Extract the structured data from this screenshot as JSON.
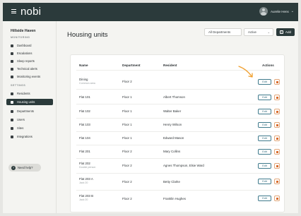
{
  "app": {
    "logo": "nobi",
    "user_name": "Aurelie Hens",
    "user_chevron": "⌄"
  },
  "sidebar": {
    "site_name": "Hillside Haven",
    "monitoring_label": "MONITORING",
    "settings_label": "SETTINGS",
    "monitoring_items": [
      {
        "label": "Dashboard",
        "icon": "grid-icon"
      },
      {
        "label": "Escalations",
        "icon": "pin-icon"
      },
      {
        "label": "Sleep reports",
        "icon": "report-icon"
      },
      {
        "label": "Technical alerts",
        "icon": "alert-icon"
      },
      {
        "label": "Monitoring events",
        "icon": "events-icon"
      }
    ],
    "settings_items": [
      {
        "label": "Residents",
        "icon": "people-icon",
        "active": false
      },
      {
        "label": "Housing units",
        "icon": "home-icon",
        "active": true
      },
      {
        "label": "Departments",
        "icon": "building-icon",
        "active": false
      },
      {
        "label": "Users",
        "icon": "users-icon",
        "active": false
      },
      {
        "label": "Sites",
        "icon": "house-icon",
        "active": false
      },
      {
        "label": "Integrations",
        "icon": "link-icon",
        "active": false
      }
    ],
    "help_label": "Need help?"
  },
  "main": {
    "title": "Housing units",
    "filter_departments": "All Departments",
    "filter_status": "Active",
    "add_label": "Add"
  },
  "table": {
    "headers": {
      "name": "Name",
      "department": "Department",
      "resident": "Resident",
      "actions": "Actions"
    },
    "edit_label": "Edit",
    "rows": [
      {
        "name": "Dining",
        "sub": "Common area",
        "department": "Floor 2",
        "resident": ""
      },
      {
        "name": "Flat 101",
        "sub": "",
        "department": "Floor 1",
        "resident": "Albert Thomson"
      },
      {
        "name": "Flat 102",
        "sub": "",
        "department": "Floor 1",
        "resident": "Walter Baker"
      },
      {
        "name": "Flat 103",
        "sub": "",
        "department": "Floor 1",
        "resident": "Henry Wilson"
      },
      {
        "name": "Flat 104",
        "sub": "",
        "department": "Floor 1",
        "resident": "Edward Mason"
      },
      {
        "name": "Flat 201",
        "sub": "",
        "department": "Floor 2",
        "resident": "Mary Collins"
      },
      {
        "name": "Flat 202",
        "sub": "Double person",
        "department": "Floor 2",
        "resident": "Agnes Thompson, Elsie Ward"
      },
      {
        "name": "Flat 203 A",
        "sub": "Jack 20",
        "department": "Floor 2",
        "resident": "Betty Clarke"
      },
      {
        "name": "Flat 203 B",
        "sub": "Jack 20",
        "department": "Floor 2",
        "resident": "Franklin Hughes"
      }
    ]
  },
  "colors": {
    "topbar": "#2b3a3b",
    "accent_edit": "#3f7a8c",
    "delete": "#d86a2c",
    "arrow": "#f0a030"
  }
}
